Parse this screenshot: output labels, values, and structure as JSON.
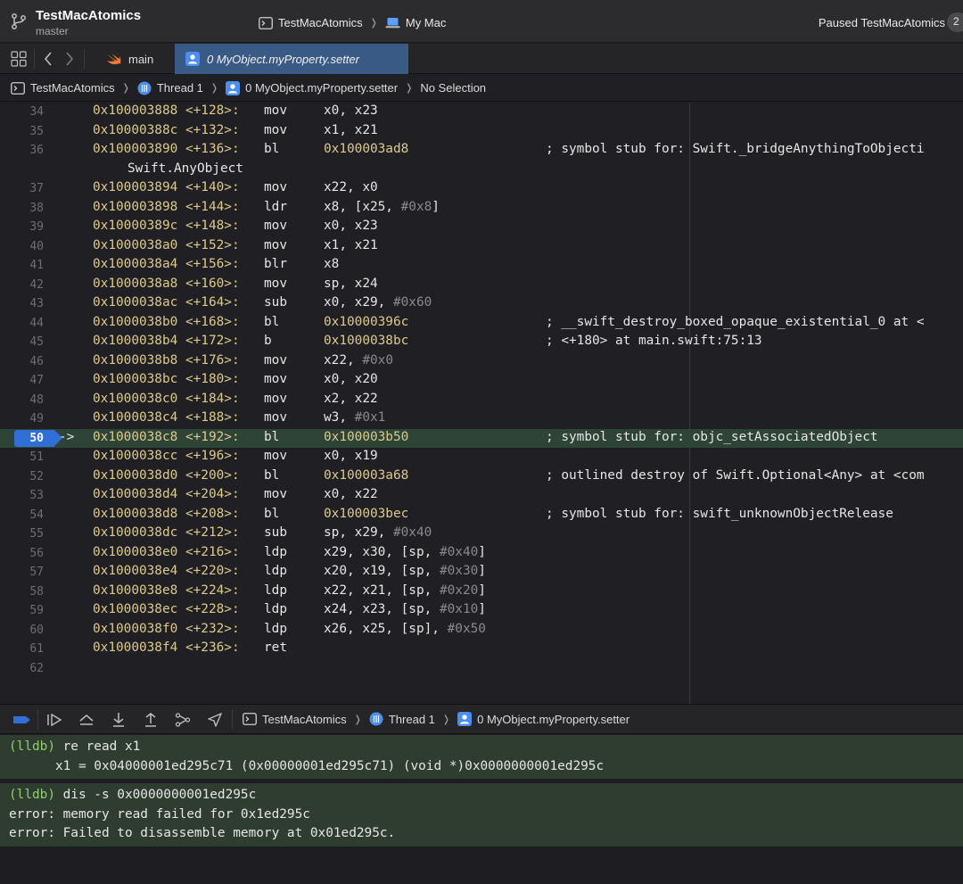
{
  "titlebar": {
    "project": "TestMacAtomics",
    "branch": "master",
    "scheme": "TestMacAtomics",
    "destination": "My Mac",
    "status": "Paused TestMacAtomics",
    "badge": "2"
  },
  "tabbar": {
    "tabs": [
      {
        "label": "main",
        "icon": "swift-icon"
      },
      {
        "label": "0 MyObject.myProperty.setter",
        "icon": "person-icon",
        "active": true
      }
    ]
  },
  "jumpbar": {
    "items": [
      "TestMacAtomics",
      "Thread 1",
      "0 MyObject.myProperty.setter",
      "No Selection"
    ]
  },
  "editor": {
    "pc_arrow": "->",
    "lines": [
      {
        "n": "34",
        "addr": "0x100003888 <+128>:",
        "mn": "mov",
        "ops": [
          {
            "t": "x0, x23"
          }
        ]
      },
      {
        "n": "35",
        "addr": "0x10000388c <+132>:",
        "mn": "mov",
        "ops": [
          {
            "t": "x1, x21"
          }
        ]
      },
      {
        "n": "36",
        "addr": "0x100003890 <+136>:",
        "mn": "bl",
        "tgt": "0x100003ad8",
        "cm": "; symbol stub for: Swift._bridgeAnythingToObjecti"
      },
      {
        "n": "",
        "cont": "Swift.AnyObject"
      },
      {
        "n": "37",
        "addr": "0x100003894 <+140>:",
        "mn": "mov",
        "ops": [
          {
            "t": "x22, x0"
          }
        ]
      },
      {
        "n": "38",
        "addr": "0x100003898 <+144>:",
        "mn": "ldr",
        "ops": [
          {
            "t": "x8, [x25, "
          },
          {
            "t": "#0x8",
            "num": true
          },
          {
            "t": "]"
          }
        ]
      },
      {
        "n": "39",
        "addr": "0x10000389c <+148>:",
        "mn": "mov",
        "ops": [
          {
            "t": "x0, x23"
          }
        ]
      },
      {
        "n": "40",
        "addr": "0x1000038a0 <+152>:",
        "mn": "mov",
        "ops": [
          {
            "t": "x1, x21"
          }
        ]
      },
      {
        "n": "41",
        "addr": "0x1000038a4 <+156>:",
        "mn": "blr",
        "ops": [
          {
            "t": "x8"
          }
        ]
      },
      {
        "n": "42",
        "addr": "0x1000038a8 <+160>:",
        "mn": "mov",
        "ops": [
          {
            "t": "sp, x24"
          }
        ]
      },
      {
        "n": "43",
        "addr": "0x1000038ac <+164>:",
        "mn": "sub",
        "ops": [
          {
            "t": "x0, x29, "
          },
          {
            "t": "#0x60",
            "num": true
          }
        ]
      },
      {
        "n": "44",
        "addr": "0x1000038b0 <+168>:",
        "mn": "bl",
        "tgt": "0x10000396c",
        "cm": "; __swift_destroy_boxed_opaque_existential_0 at <"
      },
      {
        "n": "45",
        "addr": "0x1000038b4 <+172>:",
        "mn": "b",
        "tgt": "0x1000038bc",
        "cm": "; <+180> at main.swift:75:13"
      },
      {
        "n": "46",
        "addr": "0x1000038b8 <+176>:",
        "mn": "mov",
        "ops": [
          {
            "t": "x22, "
          },
          {
            "t": "#0x0",
            "num": true
          }
        ]
      },
      {
        "n": "47",
        "addr": "0x1000038bc <+180>:",
        "mn": "mov",
        "ops": [
          {
            "t": "x0, x20"
          }
        ]
      },
      {
        "n": "48",
        "addr": "0x1000038c0 <+184>:",
        "mn": "mov",
        "ops": [
          {
            "t": "x2, x22"
          }
        ]
      },
      {
        "n": "49",
        "addr": "0x1000038c4 <+188>:",
        "mn": "mov",
        "ops": [
          {
            "t": "w3, "
          },
          {
            "t": "#0x1",
            "num": true
          }
        ]
      },
      {
        "n": "50",
        "addr": "0x1000038c8 <+192>:",
        "mn": "bl",
        "tgt": "0x100003b50",
        "cm": "; symbol stub for: objc_setAssociatedObject",
        "current": true
      },
      {
        "n": "51",
        "addr": "0x1000038cc <+196>:",
        "mn": "mov",
        "ops": [
          {
            "t": "x0, x19"
          }
        ]
      },
      {
        "n": "52",
        "addr": "0x1000038d0 <+200>:",
        "mn": "bl",
        "tgt": "0x100003a68",
        "cm": "; outlined destroy of Swift.Optional<Any> at <com"
      },
      {
        "n": "53",
        "addr": "0x1000038d4 <+204>:",
        "mn": "mov",
        "ops": [
          {
            "t": "x0, x22"
          }
        ]
      },
      {
        "n": "54",
        "addr": "0x1000038d8 <+208>:",
        "mn": "bl",
        "tgt": "0x100003bec",
        "cm": "; symbol stub for: swift_unknownObjectRelease"
      },
      {
        "n": "55",
        "addr": "0x1000038dc <+212>:",
        "mn": "sub",
        "ops": [
          {
            "t": "sp, x29, "
          },
          {
            "t": "#0x40",
            "num": true
          }
        ]
      },
      {
        "n": "56",
        "addr": "0x1000038e0 <+216>:",
        "mn": "ldp",
        "ops": [
          {
            "t": "x29, x30, [sp, "
          },
          {
            "t": "#0x40",
            "num": true
          },
          {
            "t": "]"
          }
        ]
      },
      {
        "n": "57",
        "addr": "0x1000038e4 <+220>:",
        "mn": "ldp",
        "ops": [
          {
            "t": "x20, x19, [sp, "
          },
          {
            "t": "#0x30",
            "num": true
          },
          {
            "t": "]"
          }
        ]
      },
      {
        "n": "58",
        "addr": "0x1000038e8 <+224>:",
        "mn": "ldp",
        "ops": [
          {
            "t": "x22, x21, [sp, "
          },
          {
            "t": "#0x20",
            "num": true
          },
          {
            "t": "]"
          }
        ]
      },
      {
        "n": "59",
        "addr": "0x1000038ec <+228>:",
        "mn": "ldp",
        "ops": [
          {
            "t": "x24, x23, [sp, "
          },
          {
            "t": "#0x10",
            "num": true
          },
          {
            "t": "]"
          }
        ]
      },
      {
        "n": "60",
        "addr": "0x1000038f0 <+232>:",
        "mn": "ldp",
        "ops": [
          {
            "t": "x26, x25, [sp], "
          },
          {
            "t": "#0x50",
            "num": true
          }
        ]
      },
      {
        "n": "61",
        "addr": "0x1000038f4 <+236>:",
        "mn": "ret"
      },
      {
        "n": "62"
      }
    ]
  },
  "debugbar": {
    "path": [
      "TestMacAtomics",
      "Thread 1",
      "0 MyObject.myProperty.setter"
    ]
  },
  "console": {
    "blocks": [
      {
        "lines": [
          {
            "prompt": "(lldb)",
            "text": " re read x1"
          },
          {
            "text": "      x1 = 0x04000001ed295c71 (0x00000001ed295c71) (void *)0x0000000001ed295c"
          }
        ]
      },
      {
        "lines": [
          {
            "prompt": "(lldb)",
            "text": " dis -s 0x0000000001ed295c"
          },
          {
            "text": "error: memory read failed for 0x1ed295c"
          },
          {
            "text": "error: Failed to disassemble memory at 0x01ed295c."
          }
        ]
      }
    ]
  },
  "colors": {
    "accent": "#2f6fd6",
    "current_line": "#2d4436",
    "address": "#dccb8c",
    "prompt": "#8fcf6e"
  }
}
